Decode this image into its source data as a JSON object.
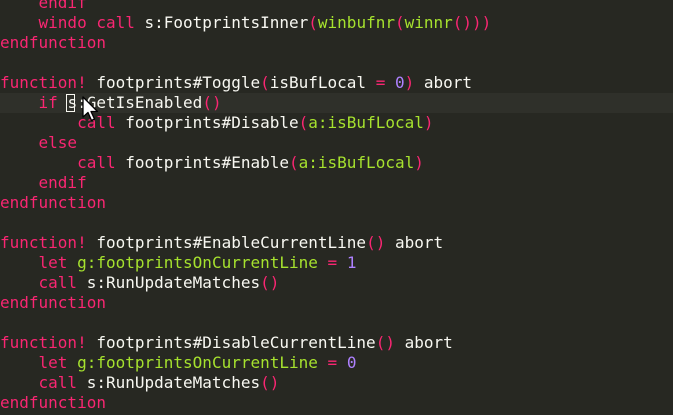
{
  "colors": {
    "background": "#272822",
    "keyword": "#f92672",
    "function_name": "#f8f8f2",
    "bracket": "#a6e22e",
    "number": "#ae81ff",
    "variable": "#a6e22e",
    "text": "#f8f8f2"
  },
  "editor": {
    "cursor_line": 6,
    "cursor_char_index": 1,
    "icons": [
      "text-cursor-block",
      "mouse-arrow-pointer-icon"
    ],
    "lines": [
      [
        {
          "t": "    ",
          "c": "text"
        },
        {
          "t": "endif",
          "c": "keyword"
        }
      ],
      [
        {
          "t": "    ",
          "c": "text"
        },
        {
          "t": "windo",
          "c": "keyword"
        },
        {
          "t": " ",
          "c": "text"
        },
        {
          "t": "call",
          "c": "keyword"
        },
        {
          "t": " s:FootprintsInner",
          "c": "text"
        },
        {
          "t": "(",
          "c": "keyword"
        },
        {
          "t": "winbufnr",
          "c": "bracket"
        },
        {
          "t": "(",
          "c": "keyword"
        },
        {
          "t": "winnr",
          "c": "bracket"
        },
        {
          "t": "()))",
          "c": "keyword"
        }
      ],
      [
        {
          "t": "endfunction",
          "c": "keyword"
        }
      ],
      [],
      [
        {
          "t": "function!",
          "c": "keyword"
        },
        {
          "t": " footprints#Toggle",
          "c": "text"
        },
        {
          "t": "(",
          "c": "keyword"
        },
        {
          "t": "isBufLocal",
          "c": "text"
        },
        {
          "t": " = ",
          "c": "keyword"
        },
        {
          "t": "0",
          "c": "number"
        },
        {
          "t": ")",
          "c": "keyword"
        },
        {
          "t": " abort",
          "c": "text"
        }
      ],
      [
        {
          "t": "    ",
          "c": "text"
        },
        {
          "t": "if",
          "c": "keyword"
        },
        {
          "t": " ",
          "c": "text"
        },
        {
          "t": "s",
          "c": "text"
        },
        {
          "t": ":GetIsEnabled",
          "c": "text"
        },
        {
          "t": "()",
          "c": "keyword"
        }
      ],
      [
        {
          "t": "        ",
          "c": "text"
        },
        {
          "t": "call",
          "c": "keyword"
        },
        {
          "t": " footprints#Disable",
          "c": "text"
        },
        {
          "t": "(",
          "c": "keyword"
        },
        {
          "t": "a:isBufLocal",
          "c": "variable"
        },
        {
          "t": ")",
          "c": "keyword"
        }
      ],
      [
        {
          "t": "    ",
          "c": "text"
        },
        {
          "t": "else",
          "c": "keyword"
        }
      ],
      [
        {
          "t": "        ",
          "c": "text"
        },
        {
          "t": "call",
          "c": "keyword"
        },
        {
          "t": " footprints#Enable",
          "c": "text"
        },
        {
          "t": "(",
          "c": "keyword"
        },
        {
          "t": "a:isBufLocal",
          "c": "variable"
        },
        {
          "t": ")",
          "c": "keyword"
        }
      ],
      [
        {
          "t": "    ",
          "c": "text"
        },
        {
          "t": "endif",
          "c": "keyword"
        }
      ],
      [
        {
          "t": "endfunction",
          "c": "keyword"
        }
      ],
      [],
      [
        {
          "t": "function!",
          "c": "keyword"
        },
        {
          "t": " footprints#EnableCurrentLine",
          "c": "text"
        },
        {
          "t": "()",
          "c": "keyword"
        },
        {
          "t": " abort",
          "c": "text"
        }
      ],
      [
        {
          "t": "    ",
          "c": "text"
        },
        {
          "t": "let",
          "c": "keyword"
        },
        {
          "t": " ",
          "c": "text"
        },
        {
          "t": "g:footprintsOnCurrentLine",
          "c": "variable"
        },
        {
          "t": " = ",
          "c": "keyword"
        },
        {
          "t": "1",
          "c": "number"
        }
      ],
      [
        {
          "t": "    ",
          "c": "text"
        },
        {
          "t": "call",
          "c": "keyword"
        },
        {
          "t": " s:RunUpdateMatches",
          "c": "text"
        },
        {
          "t": "()",
          "c": "keyword"
        }
      ],
      [
        {
          "t": "endfunction",
          "c": "keyword"
        }
      ],
      [],
      [
        {
          "t": "function!",
          "c": "keyword"
        },
        {
          "t": " footprints#DisableCurrentLine",
          "c": "text"
        },
        {
          "t": "()",
          "c": "keyword"
        },
        {
          "t": " abort",
          "c": "text"
        }
      ],
      [
        {
          "t": "    ",
          "c": "text"
        },
        {
          "t": "let",
          "c": "keyword"
        },
        {
          "t": " ",
          "c": "text"
        },
        {
          "t": "g:footprintsOnCurrentLine",
          "c": "variable"
        },
        {
          "t": " = ",
          "c": "keyword"
        },
        {
          "t": "0",
          "c": "number"
        }
      ],
      [
        {
          "t": "    ",
          "c": "text"
        },
        {
          "t": "call",
          "c": "keyword"
        },
        {
          "t": " s:RunUpdateMatches",
          "c": "text"
        },
        {
          "t": "()",
          "c": "keyword"
        }
      ],
      [
        {
          "t": "endfunction",
          "c": "keyword"
        }
      ]
    ]
  }
}
